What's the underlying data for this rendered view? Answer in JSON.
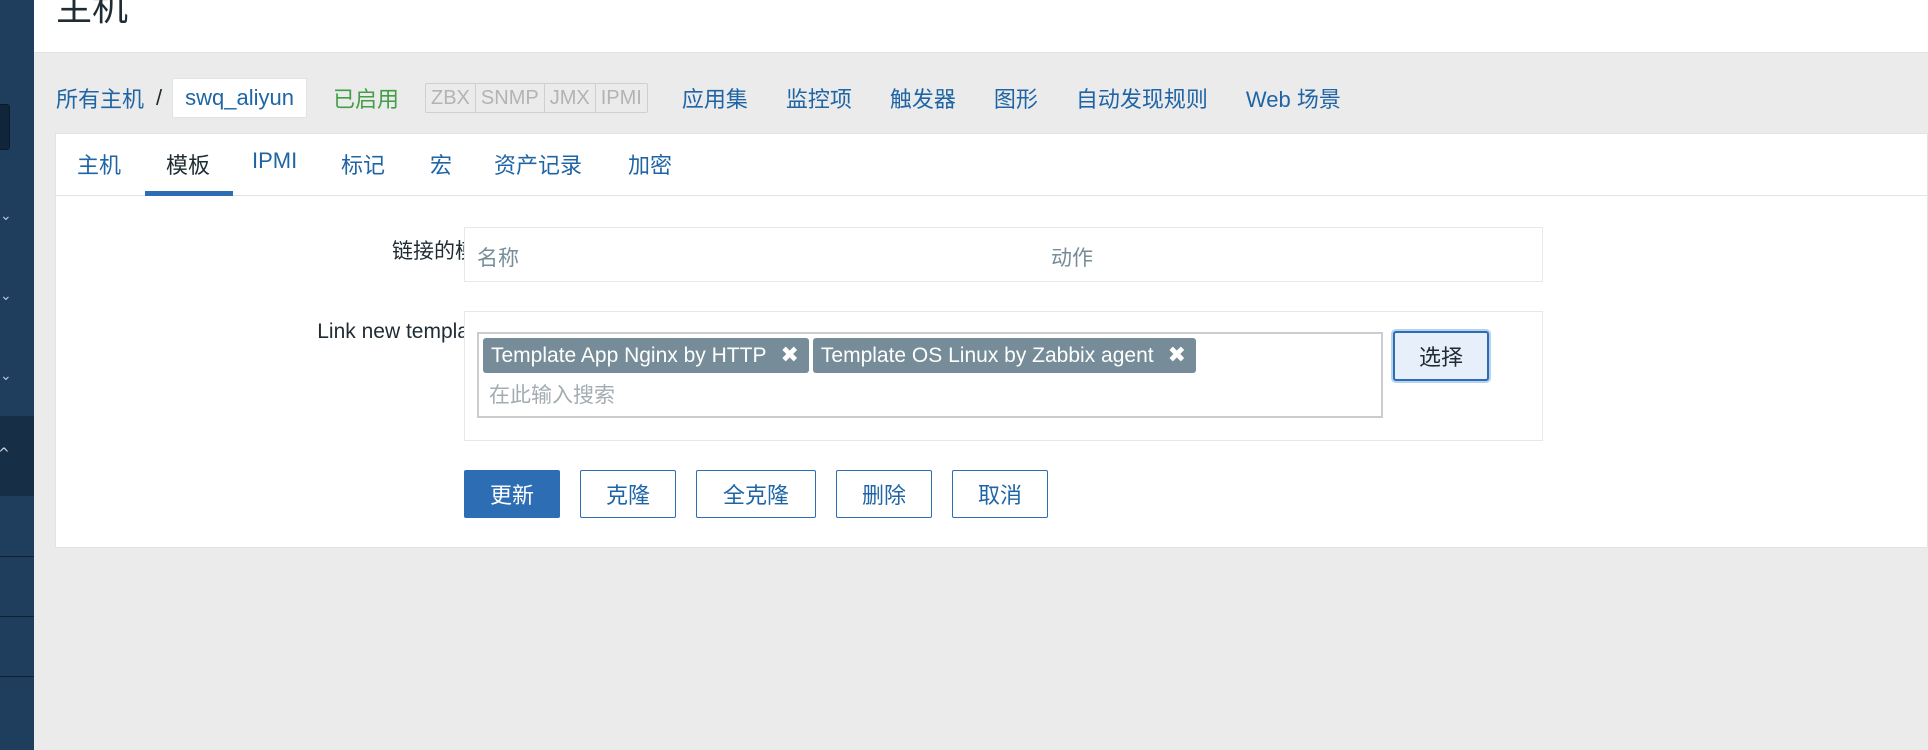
{
  "page": {
    "title": "主机"
  },
  "nav": {
    "breadcrumb_all": "所有主机",
    "breadcrumb_sep": "/",
    "host_name": "swq_aliyun",
    "status": "已启用",
    "availability": [
      "ZBX",
      "SNMP",
      "JMX",
      "IPMI"
    ],
    "links": [
      "应用集",
      "监控项",
      "触发器",
      "图形",
      "自动发现规则",
      "Web 场景"
    ]
  },
  "tabs": [
    {
      "label": "主机"
    },
    {
      "label": "模板"
    },
    {
      "label": "IPMI"
    },
    {
      "label": "标记"
    },
    {
      "label": "宏"
    },
    {
      "label": "资产记录"
    },
    {
      "label": "加密"
    }
  ],
  "form": {
    "linked_label": "链接的模板",
    "linked_cols": {
      "name": "名称",
      "action": "动作"
    },
    "new_label": "Link new templates",
    "chips": [
      {
        "label": "Template App Nginx by HTTP"
      },
      {
        "label": "Template OS Linux by Zabbix agent"
      }
    ],
    "chip_remove_glyph": "✖",
    "search_placeholder": "在此输入搜索",
    "select_label": "选择"
  },
  "buttons": {
    "update": "更新",
    "clone": "克隆",
    "full_clone": "全克隆",
    "delete": "删除",
    "cancel": "取消"
  },
  "colors": {
    "link": "#1f65a6",
    "enabled": "#429e47",
    "primary": "#2d6db3",
    "chip": "#768d99",
    "sidebar": "#1f3e5e"
  }
}
